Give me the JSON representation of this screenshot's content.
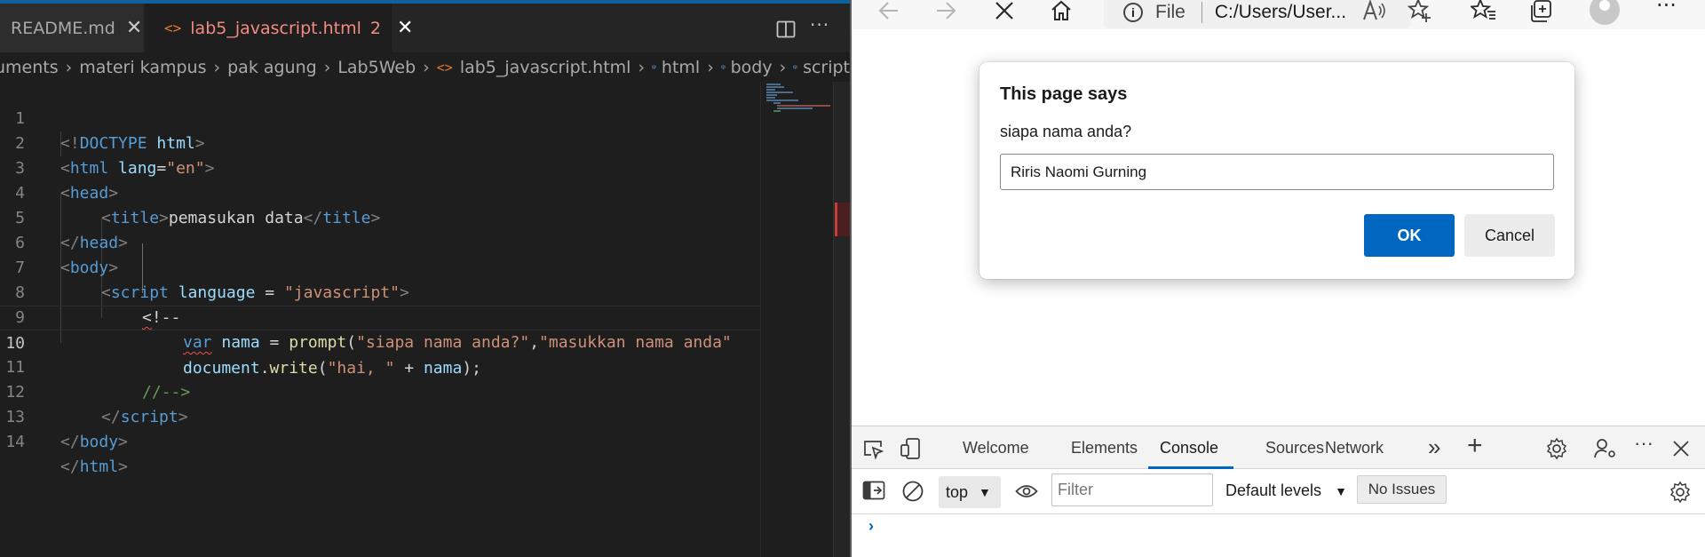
{
  "editor": {
    "tabs": [
      {
        "label": "README.md",
        "close": "✕"
      },
      {
        "icon": "<>",
        "label": "lab5_javascript.html",
        "problems": "2",
        "close": "✕"
      }
    ],
    "more": "···",
    "breadcrumb": [
      {
        "label": "uments"
      },
      {
        "label": "materi kampus"
      },
      {
        "label": "pak agung"
      },
      {
        "label": "Lab5Web"
      },
      {
        "icon": "<>",
        "label": "lab5_javascript.html"
      },
      {
        "label": "html"
      },
      {
        "label": "body"
      },
      {
        "label": "script"
      }
    ],
    "line_numbers": [
      "1",
      "2",
      "3",
      "4",
      "5",
      "6",
      "7",
      "8",
      "9",
      "10",
      "11",
      "12",
      "13",
      "14"
    ],
    "current_line": "10",
    "code": {
      "l1": [
        "<!",
        "DOCTYPE",
        " ",
        "html",
        ">"
      ],
      "l2": [
        "<",
        "html",
        " ",
        "lang",
        "=",
        "\"en\"",
        ">"
      ],
      "l3": [
        "<",
        "head",
        ">"
      ],
      "l4": [
        "<",
        "title",
        ">",
        "pemasukan data",
        "</",
        "title",
        ">"
      ],
      "l5": [
        "</",
        "head",
        ">"
      ],
      "l6": [
        "<",
        "body",
        ">"
      ],
      "l7": [
        "<",
        "script",
        " ",
        "language",
        " = ",
        "\"javascript\"",
        ">"
      ],
      "l8": [
        "<",
        "!--"
      ],
      "l9": [
        "var",
        " ",
        "nama",
        " = ",
        "prompt",
        "(",
        "\"siapa nama anda?\"",
        ",",
        "\"masukkan nama anda\""
      ],
      "l10": [
        "document",
        ".",
        "write",
        "(",
        "\"hai, \"",
        " + ",
        "nama",
        ");"
      ],
      "l11": [
        "//-->"
      ],
      "l12": [
        "</",
        "script",
        ">"
      ],
      "l13": [
        "</",
        "body",
        ">"
      ],
      "l14": [
        "</",
        "html",
        ">"
      ]
    }
  },
  "browser": {
    "toolbar": {
      "address_prefix": "File",
      "address": "C:/Users/User...",
      "more": "···"
    },
    "dialog": {
      "title": "This page says",
      "message": "siapa nama anda?",
      "input_value": "Riris Naomi Gurning",
      "ok_label": "OK",
      "cancel_label": "Cancel"
    },
    "devtools": {
      "tabs": [
        "Welcome",
        "Elements",
        "Console",
        "Sources",
        "Network"
      ],
      "active_tab": "Console",
      "context": "top",
      "filter_placeholder": "Filter",
      "levels": "Default levels",
      "issues": "No Issues",
      "prompt": "›",
      "more": "···"
    }
  },
  "colors": {
    "accent": "#0067c0",
    "vscode_bg": "#1e1e1e",
    "error": "#f14c4c"
  }
}
